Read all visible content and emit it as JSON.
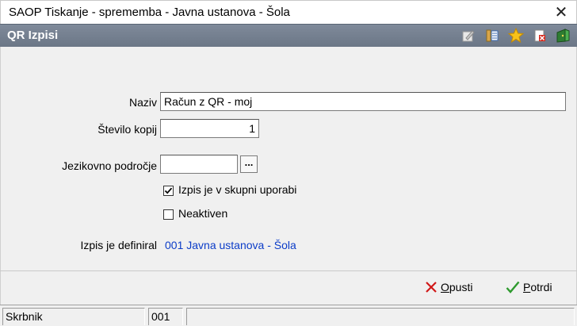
{
  "window": {
    "title": "SAOP Tiskanje - sprememba - Javna ustanova - Šola",
    "close_glyph": "✕"
  },
  "header": {
    "title": "QR Izpisi",
    "icons": [
      "edit-icon",
      "list-icon",
      "star-icon",
      "delete-icon",
      "exit-icon"
    ]
  },
  "form": {
    "naziv_label": "Naziv",
    "naziv_value": "Račun z QR - moj",
    "kopij_label": "Število kopij",
    "kopij_value": "1",
    "jezik_label": "Jezikovno področje",
    "jezik_value": "",
    "browse_label": "...",
    "skupni_label": "Izpis je v skupni uporabi",
    "skupni_checked": true,
    "neaktiven_label": "Neaktiven",
    "neaktiven_checked": false,
    "definiral_label": "Izpis je definiral",
    "definiral_value": "001 Javna ustanova - Šola"
  },
  "actions": {
    "cancel_key": "O",
    "cancel_rest": "pusti",
    "confirm_key": "P",
    "confirm_rest": "otrdi"
  },
  "statusbar": {
    "cell1": "Skrbnik",
    "cell2": "001",
    "cell3": ""
  },
  "colors": {
    "header_bg": "#737e8e",
    "link": "#0b3cc8",
    "form_bg": "#f0f0f0"
  }
}
